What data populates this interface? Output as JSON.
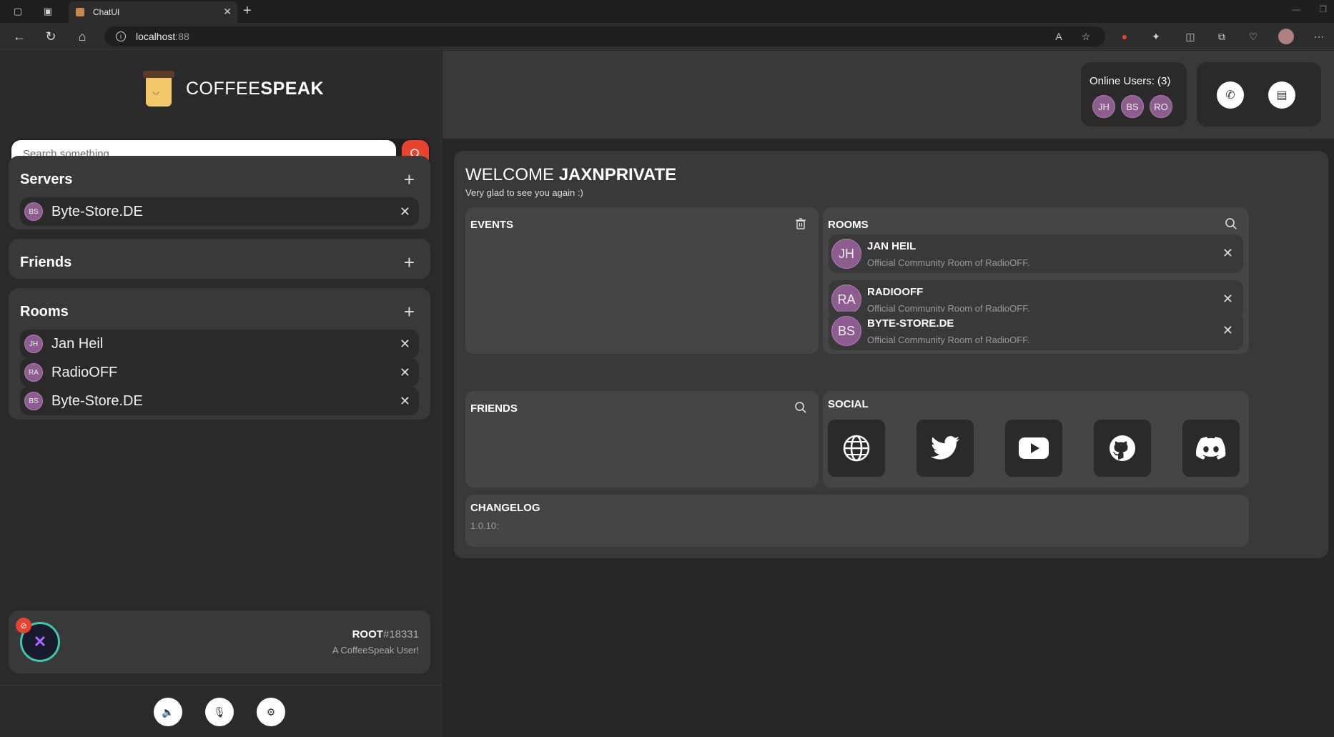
{
  "browser": {
    "tab_title": "ChatUI",
    "url_host": "localhost",
    "url_port": ":88"
  },
  "brand": {
    "name_light": "COFFEE",
    "name_bold": "SPEAK"
  },
  "search": {
    "placeholder": "Search something..."
  },
  "sidebar": {
    "servers": {
      "title": "Servers",
      "items": [
        {
          "initials": "BS",
          "label": "Byte-Store.DE"
        }
      ]
    },
    "friends": {
      "title": "Friends"
    },
    "rooms": {
      "title": "Rooms",
      "items": [
        {
          "initials": "JH",
          "label": "Jan Heil"
        },
        {
          "initials": "RA",
          "label": "RadioOFF"
        },
        {
          "initials": "BS",
          "label": "Byte-Store.DE"
        }
      ]
    }
  },
  "user": {
    "name": "ROOT",
    "tag": "#18331",
    "status": "A CoffeeSpeak User!"
  },
  "topbar": {
    "online_label": "Online Users: (3)",
    "online_users": [
      "JH",
      "BS",
      "RO"
    ]
  },
  "main": {
    "welcome_prefix": "WELCOME ",
    "welcome_name": "JAXNPRIVATE",
    "subtitle": "Very glad to see you again :)",
    "events_title": "EVENTS",
    "rooms_title": "ROOMS",
    "rooms": [
      {
        "initials": "JH",
        "name": "JAN HEIL",
        "desc": "Official Community Room of RadioOFF."
      },
      {
        "initials": "RA",
        "name": "RADIOOFF",
        "desc": "Official Community Room of RadioOFF."
      },
      {
        "initials": "BS",
        "name": "BYTE-STORE.DE",
        "desc": "Official Community Room of RadioOFF."
      }
    ],
    "friends_title": "FRIENDS",
    "social_title": "SOCIAL",
    "changelog_title": "CHANGELOG",
    "changelog_version": "1.0.10:"
  },
  "colors": {
    "accent": "#e8432e",
    "avatar": "#8d5d8f",
    "panel": "#393939",
    "card": "#454545"
  }
}
